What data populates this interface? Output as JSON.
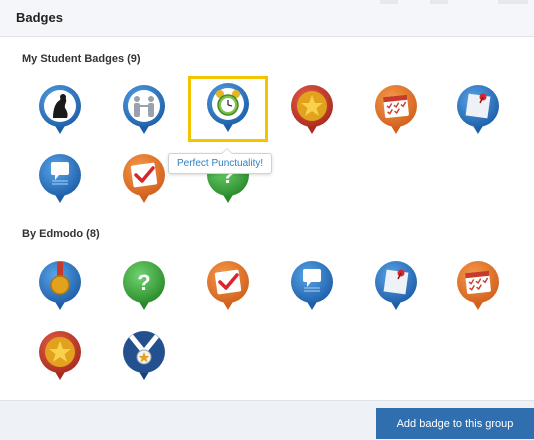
{
  "header": {
    "title": "Badges"
  },
  "sections": {
    "student": {
      "title": "My Student Badges (9)"
    },
    "edmodo": {
      "title": "By Edmodo (8)"
    }
  },
  "tooltip": {
    "text": "Perfect Punctuality!"
  },
  "footer": {
    "add_button_label": "Add badge to this group"
  },
  "colors": {
    "blue": "#2a6db5",
    "red": "#c83a2a",
    "orange": "#e6762a",
    "green": "#3aa83a",
    "accent_button": "#2f6fb0",
    "highlight": "#f5c400",
    "tooltip_text": "#2e7fc2"
  },
  "badge_icons": {
    "student": [
      "thinker-statue-badge-icon",
      "team-people-badge-icon",
      "alarm-clock-badge-icon",
      "gold-star-badge-icon",
      "calendar-checkmarks-badge-icon",
      "pinned-note-badge-icon",
      "speech-bubble-badge-icon",
      "checkmark-badge-icon",
      "question-mark-badge-icon"
    ],
    "edmodo": [
      "medal-badge-icon",
      "question-mark-badge-icon",
      "checkmark-badge-icon",
      "speech-bubble-badge-icon",
      "pinned-note-badge-icon",
      "calendar-checkmarks-badge-icon",
      "gold-star-badge-icon",
      "ribbon-medal-badge-icon"
    ]
  }
}
